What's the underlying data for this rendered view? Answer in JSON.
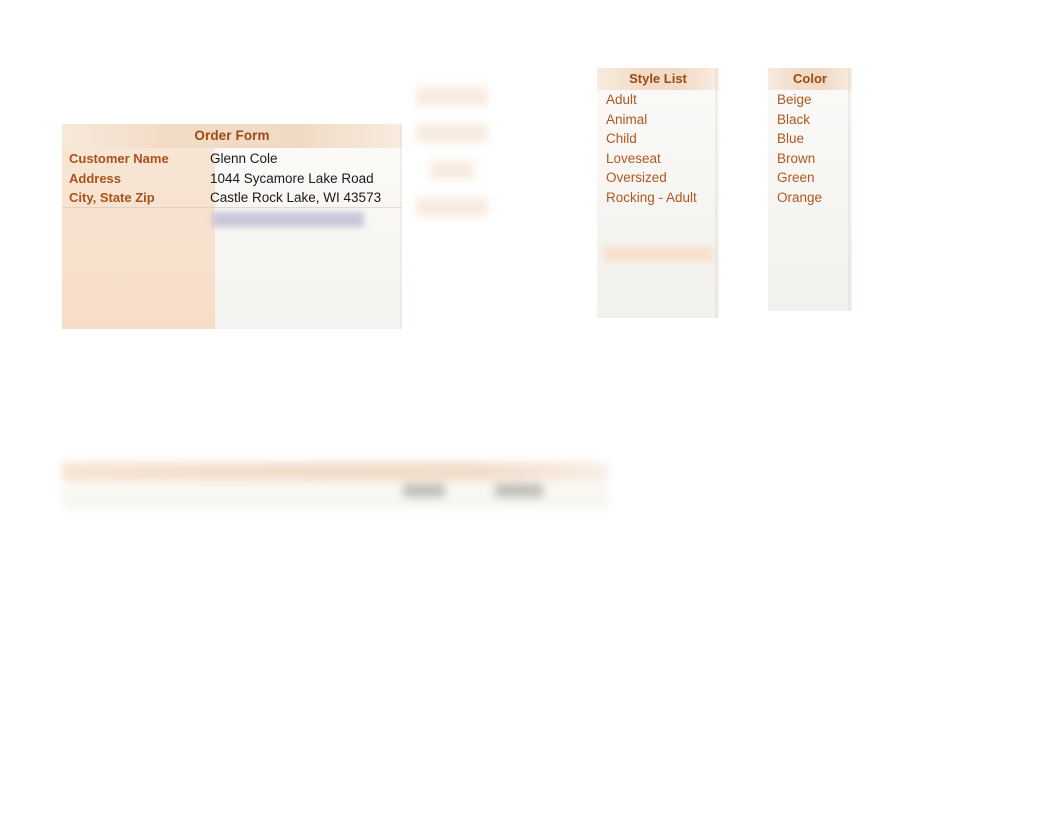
{
  "order_form": {
    "title": "Order Form",
    "rows": [
      {
        "label": "Customer Name",
        "value": "Glenn Cole"
      },
      {
        "label": "Address",
        "value": "1044 Sycamore Lake Road"
      },
      {
        "label": "City, State Zip",
        "value": "Castle Rock Lake, WI 43573"
      }
    ],
    "selected_cell_value": ""
  },
  "ghost_labels": [
    {
      "text": ""
    },
    {
      "text": ""
    },
    {
      "text": ""
    },
    {
      "text": ""
    }
  ],
  "style_list": {
    "title": "Style List",
    "items": [
      "Adult",
      "Animal",
      "Child",
      "Loveseat",
      "Oversized",
      "Rocking - Adult"
    ]
  },
  "color_list": {
    "title": "Color",
    "items": [
      "Beige",
      "Black",
      "Blue",
      "Brown",
      "Green",
      "Orange"
    ]
  },
  "bottom_bar": {
    "header_text": "",
    "value_left": "",
    "value_right": ""
  },
  "colors": {
    "header_text": "#9c4a16",
    "label_text": "#a8521c",
    "value_text": "#1a1a1a",
    "list_text": "#b0581f",
    "header_fill": "#f2dcc7",
    "left_column_fill": "#f8e2cf",
    "panel_fill": "#f7f6f3",
    "selection_fill": "#bcbcd6",
    "page_background": "#ffffff"
  }
}
